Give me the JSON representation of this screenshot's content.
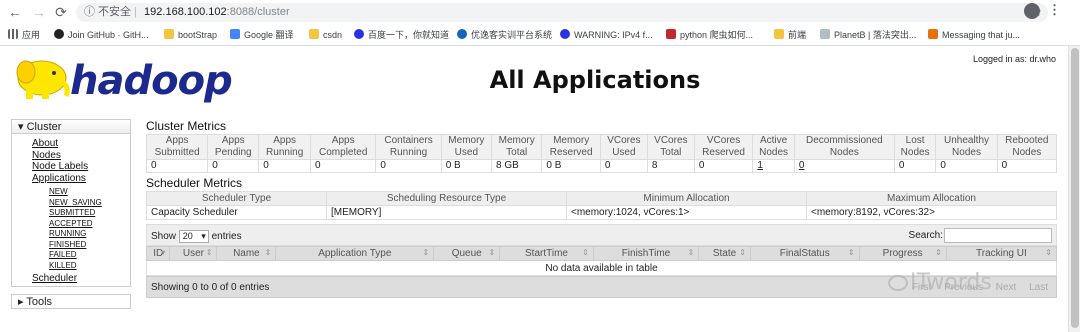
{
  "browser": {
    "back": "←",
    "forward": "→",
    "reload": "⟳",
    "security": "ⓘ 不安全",
    "url_host": "192.168.100.102",
    "url_path": ":8088/cluster",
    "bookmarks": [
      {
        "label": "应用",
        "icon": "apps-icon"
      },
      {
        "label": "Join GitHub · GitH...",
        "icon": "github-icon"
      },
      {
        "label": "bootStrap",
        "icon": "folder-icon"
      },
      {
        "label": "Google 翻译",
        "icon": "google-translate-icon"
      },
      {
        "label": "csdn",
        "icon": "folder-icon"
      },
      {
        "label": "百度一下，你就知道",
        "icon": "baidu-icon"
      },
      {
        "label": "优逸客实训平台系统",
        "icon": "edu-icon"
      },
      {
        "label": "WARNING: IPv4 f...",
        "icon": "baidu-icon"
      },
      {
        "label": "python 爬虫如何...",
        "icon": "csdn-icon"
      },
      {
        "label": "前端",
        "icon": "folder-icon"
      },
      {
        "label": "PlanetB | 落法突出...",
        "icon": "page-icon"
      },
      {
        "label": "Messaging that ju...",
        "icon": "messaging-icon"
      }
    ]
  },
  "header": {
    "logo_text": "hadoop",
    "title": "All Applications",
    "logged_in": "Logged in as: dr.who"
  },
  "sidebar": {
    "cluster_label": "▾ Cluster",
    "links": [
      "About",
      "Nodes",
      "Node Labels",
      "Applications"
    ],
    "app_states": [
      "NEW",
      "NEW_SAVING",
      "SUBMITTED",
      "ACCEPTED",
      "RUNNING",
      "FINISHED",
      "FAILED",
      "KILLED"
    ],
    "scheduler": "Scheduler",
    "tools_label": "▸ Tools"
  },
  "cluster_metrics": {
    "title": "Cluster Metrics",
    "headers": [
      [
        "Apps",
        "Submitted"
      ],
      [
        "Apps",
        "Pending"
      ],
      [
        "Apps",
        "Running"
      ],
      [
        "Apps",
        "Completed"
      ],
      [
        "Containers",
        "Running"
      ],
      [
        "Memory",
        "Used"
      ],
      [
        "Memory",
        "Total"
      ],
      [
        "Memory",
        "Reserved"
      ],
      [
        "VCores",
        "Used"
      ],
      [
        "VCores",
        "Total"
      ],
      [
        "VCores",
        "Reserved"
      ],
      [
        "Active",
        "Nodes"
      ],
      [
        "Decommissioned",
        "Nodes"
      ],
      [
        "Lost",
        "Nodes"
      ],
      [
        "Unhealthy",
        "Nodes"
      ],
      [
        "Rebooted",
        "Nodes"
      ]
    ],
    "values": [
      "0",
      "0",
      "0",
      "0",
      "0",
      "0 B",
      "8 GB",
      "0 B",
      "0",
      "8",
      "0",
      "1",
      "0",
      "0",
      "0",
      "0"
    ]
  },
  "scheduler_metrics": {
    "title": "Scheduler Metrics",
    "headers": [
      "Scheduler Type",
      "Scheduling Resource Type",
      "Minimum Allocation",
      "Maximum Allocation"
    ],
    "values": [
      "Capacity Scheduler",
      "[MEMORY]",
      "<memory:1024, vCores:1>",
      "<memory:8192, vCores:32>"
    ]
  },
  "apps_table": {
    "show_label": "Show",
    "page_size": "20",
    "entries_label": "entries",
    "search_label": "Search:",
    "columns": [
      "ID",
      "User",
      "Name",
      "Application Type",
      "Queue",
      "StartTime",
      "FinishTime",
      "State",
      "FinalStatus",
      "Progress",
      "Tracking UI"
    ],
    "empty_message": "No data available in table",
    "info": "Showing 0 to 0 of 0 entries",
    "pager": [
      "First",
      "Previous",
      "Next",
      "Last"
    ]
  },
  "watermark": "ITwords"
}
